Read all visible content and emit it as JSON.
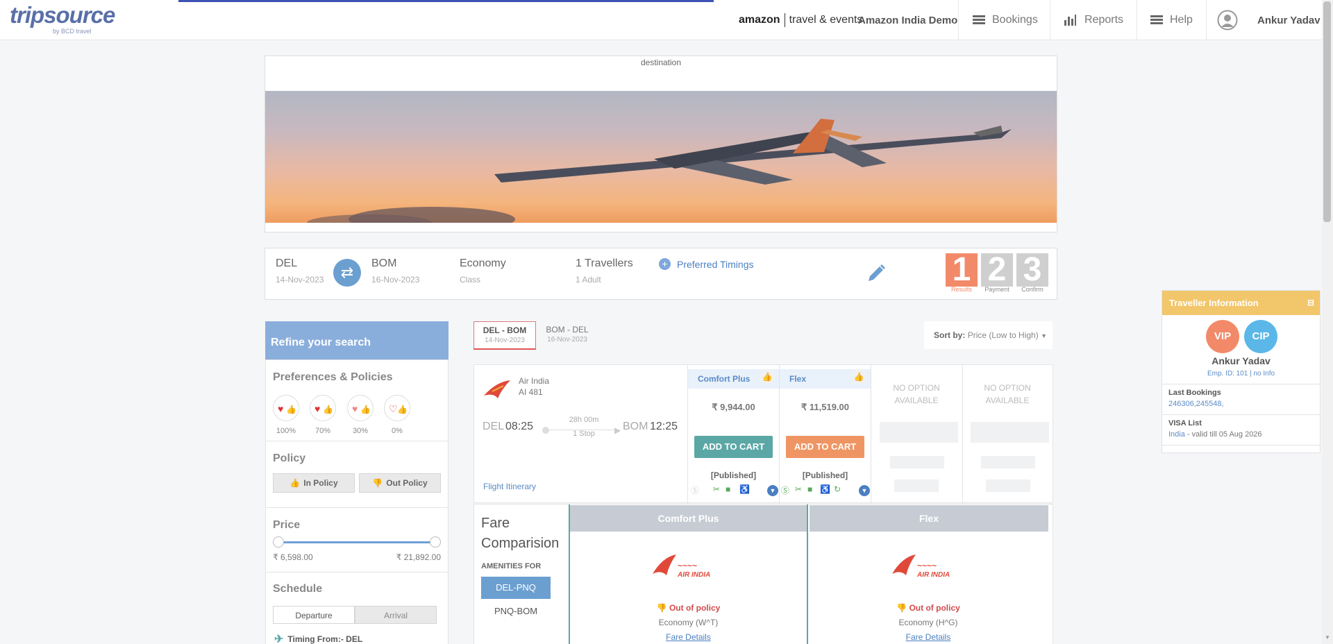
{
  "header": {
    "logo": "tripsource",
    "logo_sub": "by BCD travel",
    "brand_a": "amazon",
    "brand_b": "travel & events",
    "org": "Amazon India Demo",
    "nav": {
      "bookings": "Bookings",
      "reports": "Reports",
      "help": "Help"
    },
    "user": "Ankur Yadav"
  },
  "hero": {
    "label": "destination"
  },
  "search": {
    "from_code": "DEL",
    "from_date": "14-Nov-2023",
    "to_code": "BOM",
    "to_date": "16-Nov-2023",
    "class_value": "Economy",
    "class_label": "Class",
    "travellers": "1 Travellers",
    "travellers_sub": "1 Adult",
    "preferred": "Preferred Timings",
    "steps": [
      {
        "num": "1",
        "label": "Results",
        "color": "#f28a6a"
      },
      {
        "num": "2",
        "label": "Payment",
        "color": "#cfcfcf"
      },
      {
        "num": "3",
        "label": "Confirm",
        "color": "#cfcfcf"
      }
    ]
  },
  "refine": {
    "title": "Refine your search",
    "pref_title": "Preferences & Policies",
    "pref_levels": [
      "100%",
      "70%",
      "30%",
      "0%"
    ],
    "policy_title": "Policy",
    "in_policy": "In Policy",
    "out_policy": "Out Policy",
    "price_title": "Price",
    "price_min": "₹ 6,598.00",
    "price_max": "₹ 21,892.00",
    "schedule_title": "Schedule",
    "departure": "Departure",
    "arrival": "Arrival",
    "timing": "Timing From:- DEL"
  },
  "trips": [
    {
      "route": "DEL  -  BOM",
      "date": "14-Nov-2023"
    },
    {
      "route": "BOM  -  DEL",
      "date": "16-Nov-2023"
    }
  ],
  "sort": {
    "label": "Sort by:",
    "value": "Price (Low to High)"
  },
  "flight": {
    "airline": "Air India",
    "number": "AI  481",
    "dep_code": "DEL",
    "dep_time": "08:25",
    "duration": "28h 00m",
    "stops": "1 Stop",
    "arr_code": "BOM",
    "arr_time": "12:25",
    "itinerary": "Flight Itinerary"
  },
  "fares": [
    {
      "name": "Comfort Plus",
      "price": "₹ 9,944.00",
      "cart": "ADD TO CART",
      "type": "[Published]",
      "cart_color": "#5ba7a6"
    },
    {
      "name": "Flex",
      "price": "₹ 11,519.00",
      "cart": "ADD TO CART",
      "type": "[Published]",
      "cart_color": "#ef9563"
    }
  ],
  "no_option": "NO OPTION AVAILABLE",
  "compare": {
    "title1": "Fare",
    "title2": "Comparision",
    "amen_label": "AMENITIES FOR",
    "seg1": "DEL-PNQ",
    "seg2": "PNQ-BOM",
    "cols": [
      {
        "name": "Comfort Plus",
        "policy": "Out of policy",
        "econ": "Economy (W^T)",
        "details": "Fare Details"
      },
      {
        "name": "Flex",
        "policy": "Out of policy",
        "econ": "Economy (H^G)",
        "details": "Fare Details"
      }
    ]
  },
  "traveller": {
    "title": "Traveller Information",
    "vip": "VIP",
    "cip": "CIP",
    "name": "Ankur Yadav",
    "emp": "Emp. ID: 101 | no Info",
    "last_label": "Last Bookings",
    "last_value": "246306,245548,",
    "visa_label": "VISA List",
    "visa_country": "India",
    "visa_valid": " - valid till 05 Aug 2026"
  }
}
